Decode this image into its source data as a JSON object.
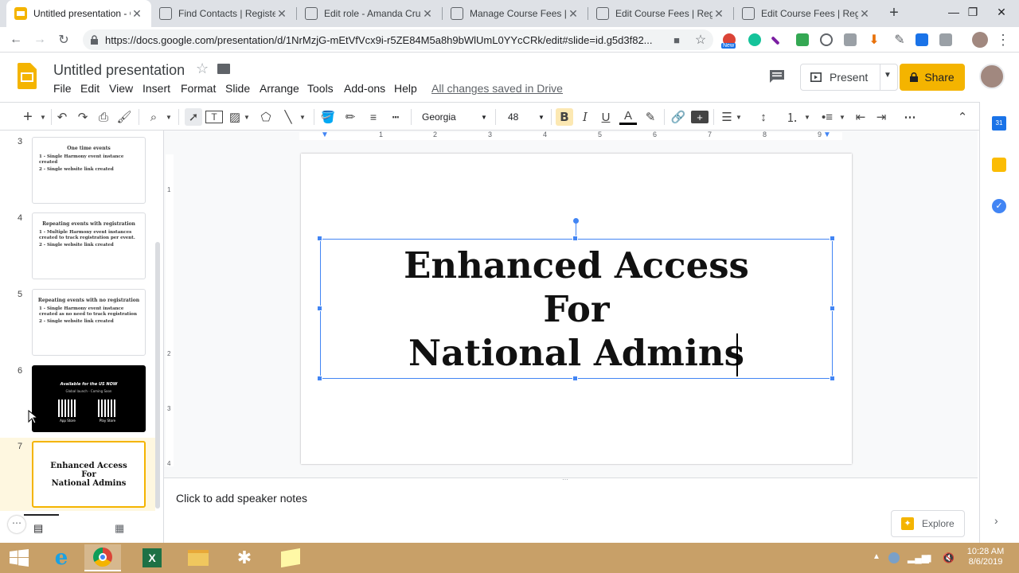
{
  "browser": {
    "tabs": [
      {
        "title": "Untitled presentation - G"
      },
      {
        "title": "Find Contacts | Register"
      },
      {
        "title": "Edit role - Amanda Cruz"
      },
      {
        "title": "Manage Course Fees | Re"
      },
      {
        "title": "Edit Course Fees | Regist"
      },
      {
        "title": "Edit Course Fees | Regist"
      }
    ],
    "url": "https://docs.google.com/presentation/d/1NrMzjG-mEtVfVcx9i-r5ZE84M5a8h9bWlUmL0YYcCRk/edit#slide=id.g5d3f82...",
    "ext_new_badge": "New"
  },
  "app": {
    "title": "Untitled presentation",
    "menu": [
      "File",
      "Edit",
      "View",
      "Insert",
      "Format",
      "Slide",
      "Arrange",
      "Tools",
      "Add-ons",
      "Help"
    ],
    "saved_status": "All changes saved in Drive",
    "present_label": "Present",
    "share_label": "Share"
  },
  "toolbar": {
    "font": "Georgia",
    "font_size": "48"
  },
  "ruler": {
    "h_ticks": [
      "1",
      "2",
      "3",
      "4",
      "5",
      "6",
      "7",
      "8",
      "9"
    ],
    "v_ticks": [
      "1",
      "2",
      "3",
      "4"
    ]
  },
  "filmstrip": {
    "slides": [
      {
        "num": "3",
        "title": "One time events",
        "lines": [
          "1 - Single Harmony event instance created",
          "2 - Single website link created"
        ]
      },
      {
        "num": "4",
        "title": "Repeating events with registration",
        "lines": [
          "1 - Multiple Harmony event instances created to track registration per event.",
          "2 - Single website link created"
        ]
      },
      {
        "num": "5",
        "title": "Repeating events with no registration",
        "lines": [
          "1 - Single Harmony event instance created as no need to track registration",
          "2 - Single website link created"
        ]
      },
      {
        "num": "6",
        "title": "Available for the US NOW",
        "subtitle": "Global launch - Coming Soon",
        "badges": [
          "App Store",
          "Play Store"
        ]
      },
      {
        "num": "7",
        "lines": [
          "Enhanced Access",
          "For",
          "National Admins"
        ]
      }
    ]
  },
  "slide": {
    "lines": [
      "Enhanced Access",
      "For",
      "National Admins"
    ]
  },
  "notes": {
    "placeholder": "Click to add speaker notes"
  },
  "explore_label": "Explore",
  "calendar_day": "31",
  "taskbar": {
    "time": "10:28 AM",
    "date": "8/6/2019"
  },
  "colors": {
    "accent": "#f4b400",
    "selection": "#4285f4",
    "taskbar": "#c8a068"
  }
}
